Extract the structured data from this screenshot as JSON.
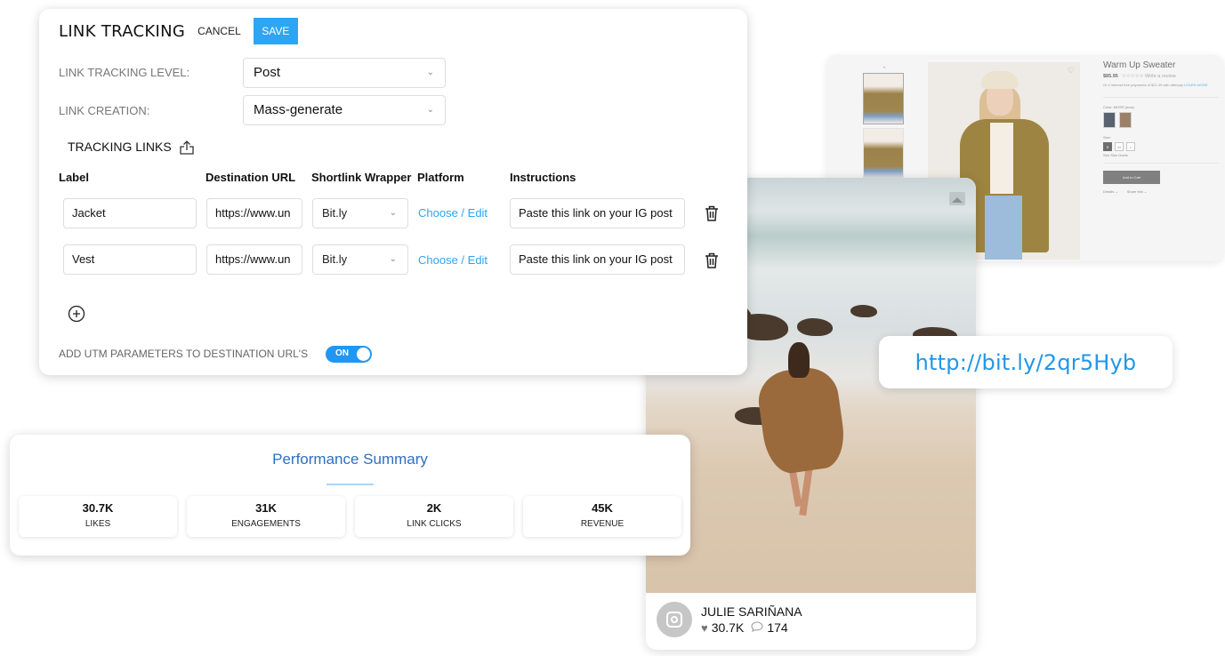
{
  "link_tracking": {
    "title": "LINK TRACKING",
    "cancel_label": "CANCEL",
    "save_label": "SAVE",
    "tracking_level_label": "LINK TRACKING LEVEL:",
    "tracking_level_value": "Post",
    "link_creation_label": "LINK CREATION:",
    "link_creation_value": "Mass-generate",
    "tracking_links_label": "TRACKING LINKS",
    "columns": [
      "Label",
      "Destination URL",
      "Shortlink Wrapper",
      "Platform",
      "Instructions"
    ],
    "rows": [
      {
        "label": "Jacket",
        "destination_url": "https://www.un",
        "shortlink_wrapper": "Bit.ly",
        "platform": "Choose / Edit",
        "instructions": "Paste this link on your IG post"
      },
      {
        "label": "Vest",
        "destination_url": "https://www.un",
        "shortlink_wrapper": "Bit.ly",
        "platform": "Choose / Edit",
        "instructions": "Paste this link on your IG post"
      }
    ],
    "utm_label": "ADD UTM PARAMETERS TO DESTINATION URL'S",
    "utm_toggle": "ON",
    "accent_color": "#2ea5f3"
  },
  "performance_summary": {
    "title": "Performance Summary",
    "metrics": [
      {
        "value": "30.7K",
        "label": "LIKES"
      },
      {
        "value": "31K",
        "label": "ENGAGEMENTS"
      },
      {
        "value": "2K",
        "label": "LINK CLICKS"
      },
      {
        "value": "45K",
        "label": "REVENUE"
      }
    ]
  },
  "product_page": {
    "title": "Warm Up Sweater",
    "price": "$85.95",
    "review_link": "Write a review",
    "payment_note": "Or 4 interest free payments of $21.49 with afterpay",
    "learn_more": "LEARN MORE",
    "color_label": "Color: MOSS (mos)",
    "size_label": "Size:",
    "sizes": [
      "S",
      "M",
      "L"
    ],
    "selected_size": "S",
    "size_guide": "See Size Guide",
    "add_to_cart": "Add to Cart",
    "details": "Details",
    "share": "Share this"
  },
  "shortlink": {
    "url": "http://bit.ly/2qr5Hyb"
  },
  "instagram_post": {
    "author": "JULIE SARIÑANA",
    "likes": "30.7K",
    "comments": "174"
  }
}
